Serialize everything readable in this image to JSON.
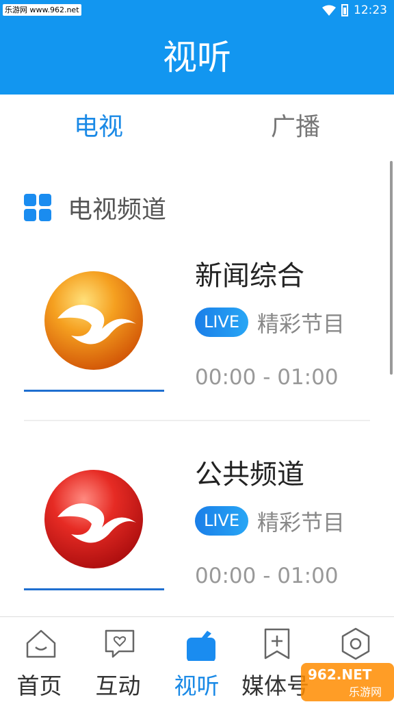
{
  "status_bar": {
    "watermark": "乐游网 www.962.net",
    "time": "12:23",
    "icons": [
      "wifi-icon",
      "battery-icon"
    ]
  },
  "app_bar": {
    "title": "视听"
  },
  "tabs": [
    {
      "label": "电视",
      "active": true
    },
    {
      "label": "广播",
      "active": false
    }
  ],
  "section": {
    "title": "电视频道",
    "icon": "grid-icon"
  },
  "channels": [
    {
      "name": "新闻综合",
      "badge": "LIVE",
      "program": "精彩节目",
      "time": "00:00 - 01:00",
      "logo_color": "#f08a1c"
    },
    {
      "name": "公共频道",
      "badge": "LIVE",
      "program": "精彩节目",
      "time": "00:00 - 01:00",
      "logo_color": "#e3221f"
    }
  ],
  "bottom_nav": [
    {
      "label": "首页",
      "icon": "home-icon",
      "active": false
    },
    {
      "label": "互动",
      "icon": "chat-heart-icon",
      "active": false
    },
    {
      "label": "视听",
      "icon": "tv-icon",
      "active": true
    },
    {
      "label": "媒体号",
      "icon": "bookmark-plus-icon",
      "active": false
    },
    {
      "label": "",
      "icon": "hexagon-icon",
      "active": false
    }
  ],
  "watermark_overlay": "962.NET 乐游网",
  "colors": {
    "primary": "#1296f0",
    "tab_active": "#1989e6",
    "live_badge": "#1a8cf0"
  }
}
